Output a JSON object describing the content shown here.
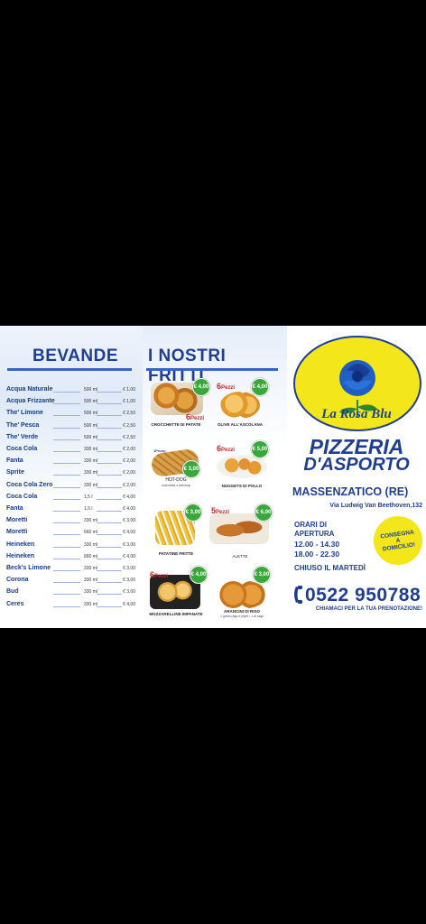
{
  "bevande": {
    "title": "BEVANDE",
    "items": [
      {
        "name": "Acqua Naturale",
        "size": "500 ml",
        "price": "€ 1,00"
      },
      {
        "name": "Acqua Frizzante",
        "size": "500 ml",
        "price": "€ 1,00"
      },
      {
        "name": "The' Limone",
        "size": "500 ml",
        "price": "€ 2,50"
      },
      {
        "name": "The' Pesca",
        "size": "500 ml",
        "price": "€ 2,50"
      },
      {
        "name": "The' Verde",
        "size": "500 ml",
        "price": "€ 2,50"
      },
      {
        "name": "Coca Cola",
        "size": "330 ml",
        "price": "€ 2,00"
      },
      {
        "name": "Fanta",
        "size": "330 ml",
        "price": "€ 2,00"
      },
      {
        "name": "Sprite",
        "size": "330 ml",
        "price": "€ 2,00"
      },
      {
        "name": "Coca Cola Zero",
        "size": "330 ml",
        "price": "€ 2,00"
      },
      {
        "name": "Coca Cola",
        "size": "1,5 l",
        "price": "€ 4,00"
      },
      {
        "name": "Fanta",
        "size": "1,5 l",
        "price": "€ 4,00"
      },
      {
        "name": "Moretti",
        "size": "330 ml",
        "price": "€ 3,00"
      },
      {
        "name": "Moretti",
        "size": "660 ml",
        "price": "€ 4,00"
      },
      {
        "name": "Heineken",
        "size": "330 ml",
        "price": "€ 3,00"
      },
      {
        "name": "Heineken",
        "size": "660 ml",
        "price": "€ 4,00"
      },
      {
        "name": "Beck's Limone",
        "size": "330 ml",
        "price": "€ 3,00"
      },
      {
        "name": "Corona",
        "size": "330 ml",
        "price": "€ 3,00"
      },
      {
        "name": "Bud",
        "size": "330 ml",
        "price": "€ 3,00"
      },
      {
        "name": "Ceres",
        "size": "330 ml",
        "price": "€ 4,00"
      }
    ]
  },
  "fritti": {
    "title": "I NOSTRI FRITTI",
    "items": [
      {
        "caption": "CROCCHETTE DI PATATE",
        "price": "€ 4,00",
        "pieces": "6",
        "pieces_word": "Pezzi"
      },
      {
        "caption": "OLIVE ALL'ASCOLANA",
        "price": "€ 4,00",
        "pieces": "6",
        "pieces_word": "Pezzi"
      },
      {
        "caption": "HOT-DOG",
        "sub": "maionese e ketchup",
        "price": "€ 3,00",
        "pieces": "1",
        "pieces_word": "Pezzo"
      },
      {
        "caption": "NUGGETS DI POLLO",
        "price": "€ 5,00",
        "pieces": "6",
        "pieces_word": "Pezzi"
      },
      {
        "caption": "PATATINE FRITTE",
        "price": "€ 3,00"
      },
      {
        "caption": "ALETTE",
        "price": "€ 6,00",
        "pieces": "5",
        "pieces_word": "Pezzi"
      },
      {
        "caption": "MOZZARELLINE IMPANATE",
        "price": "€ 4,00",
        "pieces": "6",
        "pieces_word": "Pezzi"
      },
      {
        "caption": "ARANCINI DI RISO",
        "sub": "1 gusto ragù e pepe • 1 al ragù",
        "price": "€ 3,00"
      }
    ]
  },
  "brand": {
    "logo_text": "La Rosa Blu",
    "line1": "PIZZERIA",
    "line2": "D'ASPORTO",
    "town": "MASSENZATICO (RE)",
    "address": "Via Ludwig Van Beethoven,132",
    "hours_label1": "ORARI DI",
    "hours_label2": "APERTURA",
    "hours1": "12.00 - 14.30",
    "hours2": "18.00 - 22.30",
    "closed": "CHIUSO IL MARTEDÌ",
    "delivery1": "CONSEGNA",
    "delivery2": "A",
    "delivery3": "DOMICILIO!",
    "phone": "0522 950788",
    "call": "CHIAMACI PER LA TUA PRENOTAZIONE!",
    "colors": {
      "blue": "#1f3e93",
      "yellow": "#f3e61a",
      "green": "#39a83b",
      "red": "#d62020"
    }
  }
}
